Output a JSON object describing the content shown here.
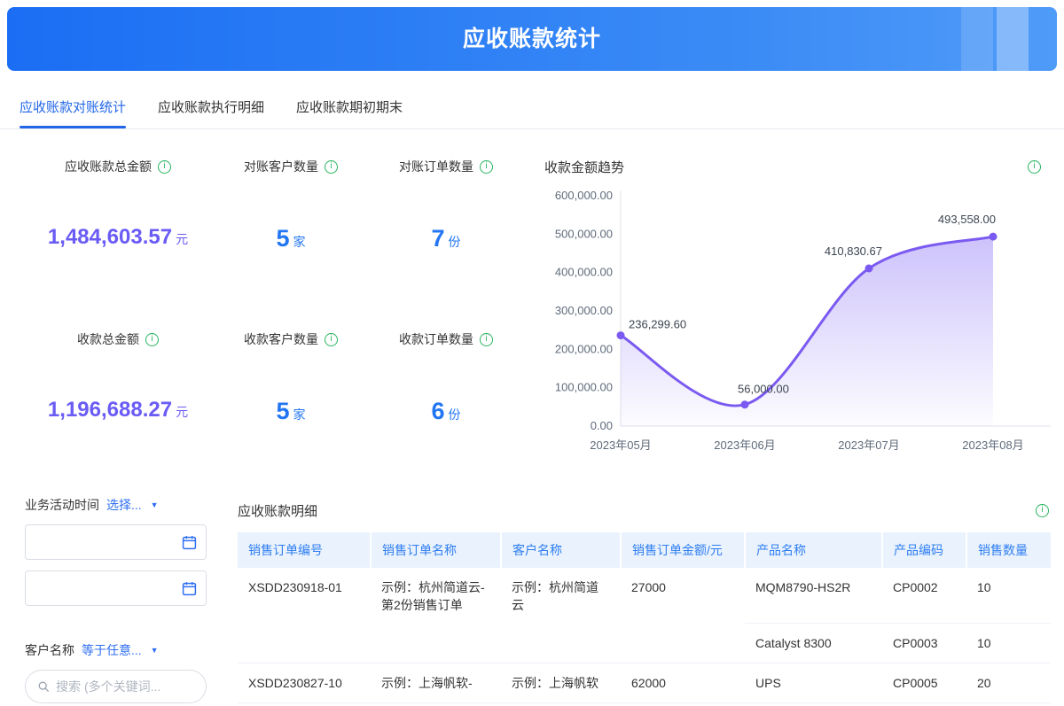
{
  "page": {
    "title": "应收账款统计"
  },
  "colors": {
    "banner_gradient": [
      "#1b6ef3",
      "#4f9bf8"
    ],
    "accent_blue": "#2266e8",
    "amount_purple": "#6a5bf5",
    "count_blue": "#2276f2",
    "info_green": "#27b45e",
    "chart_line": "#7a5af0",
    "table_header_bg": "#e9f2fd",
    "table_header_text": "#2f7ef2"
  },
  "icons": {
    "info": "i",
    "caret": "▼"
  },
  "tabs": [
    {
      "label": "应收账款对账统计",
      "active": true
    },
    {
      "label": "应收账款执行明细",
      "active": false
    },
    {
      "label": "应收账款期初期末",
      "active": false
    }
  ],
  "stats": {
    "items": [
      {
        "label": "应收账款总金额",
        "value": "1,484,603.57",
        "unit": "元",
        "type": "amount"
      },
      {
        "label": "对账客户数量",
        "value": "5",
        "unit": "家",
        "type": "count"
      },
      {
        "label": "对账订单数量",
        "value": "7",
        "unit": "份",
        "type": "count"
      },
      {
        "label": "收款总金额",
        "value": "1,196,688.27",
        "unit": "元",
        "type": "amount"
      },
      {
        "label": "收款客户数量",
        "value": "5",
        "unit": "家",
        "type": "count"
      },
      {
        "label": "收款订单数量",
        "value": "6",
        "unit": "份",
        "type": "count"
      }
    ]
  },
  "chart": {
    "title": "收款金额趋势"
  },
  "chart_data": {
    "type": "area",
    "title": "收款金额趋势",
    "x": [
      "2023年05月",
      "2023年06月",
      "2023年07月",
      "2023年08月"
    ],
    "values": [
      236299.6,
      56000.0,
      410830.67,
      493558.0
    ],
    "point_labels": [
      "236,299.60",
      "56,000.00",
      "410,830.67",
      "493,558.00"
    ],
    "ylim": [
      0,
      600000
    ],
    "ytick_labels": [
      "0.00",
      "100,000.00",
      "200,000.00",
      "300,000.00",
      "400,000.00",
      "500,000.00",
      "600,000.00"
    ],
    "line_color": "#7a5af0",
    "grid": false,
    "legend": false
  },
  "filters": {
    "time_label": "业务活动时间",
    "time_op": "选择...",
    "customer_label": "客户名称",
    "customer_op": "等于任意...",
    "search_placeholder": "搜索 (多个关键词..."
  },
  "detail": {
    "title": "应收账款明细",
    "columns": [
      "销售订单编号",
      "销售订单名称",
      "客户名称",
      "销售订单金额/元",
      "产品名称",
      "产品编码",
      "销售数量"
    ],
    "orders": [
      {
        "order_no": "XSDD230918-01",
        "order_name": "示例：杭州简道云-第2份销售订单",
        "customer": "示例：杭州简道云",
        "amount": "27000",
        "products": [
          {
            "name": "MQM8790-HS2R",
            "code": "CP0002",
            "qty": "10"
          },
          {
            "name": "Catalyst 8300",
            "code": "CP0003",
            "qty": "10"
          }
        ]
      },
      {
        "order_no": "XSDD230827-10",
        "order_name": "示例：上海帆软-",
        "customer": "示例：上海帆软",
        "amount": "62000",
        "products": [
          {
            "name": "UPS",
            "code": "CP0005",
            "qty": "20"
          }
        ]
      }
    ]
  }
}
